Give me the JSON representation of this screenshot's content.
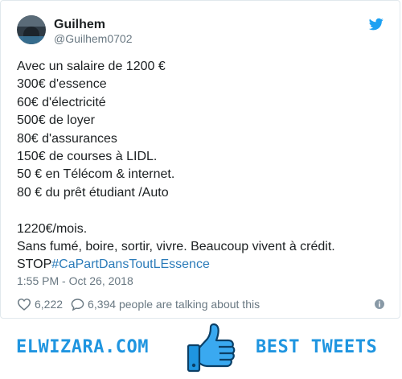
{
  "tweet": {
    "author_name": "Guilhem",
    "author_handle": "@Guilhem0702",
    "lines": [
      "Avec un salaire de 1200 €",
      "300€ d'essence",
      "60€ d'électricité",
      "500€ de loyer",
      "80€ d'assurances",
      "150€ de courses à LIDL.",
      "50 € en Télécom & internet.",
      "80 € du prêt étudiant /Auto"
    ],
    "total_line": "1220€/mois.",
    "closing_line": "Sans fumé, boire, sortir, vivre. Beaucoup vivent à crédit.",
    "stop_prefix": "STOP",
    "hashtag": "#CaPartDansToutLEssence",
    "timestamp": "1:55 PM - Oct 26, 2018",
    "likes": "6,222",
    "talking": "6,394 people are talking about this"
  },
  "icons": {
    "brand": "twitter-bird-icon",
    "like": "heart-icon",
    "reply": "speech-bubble-icon",
    "info": "info-icon",
    "footer": "thumbs-up-icon"
  },
  "footer": {
    "left_brand": "ELWIZARA.COM",
    "right_brand": "BEST TWEETS"
  },
  "colors": {
    "accent": "#1da1f2",
    "link": "#2b7bb9",
    "muted": "#697882",
    "footer_blue": "#1f95e0"
  }
}
